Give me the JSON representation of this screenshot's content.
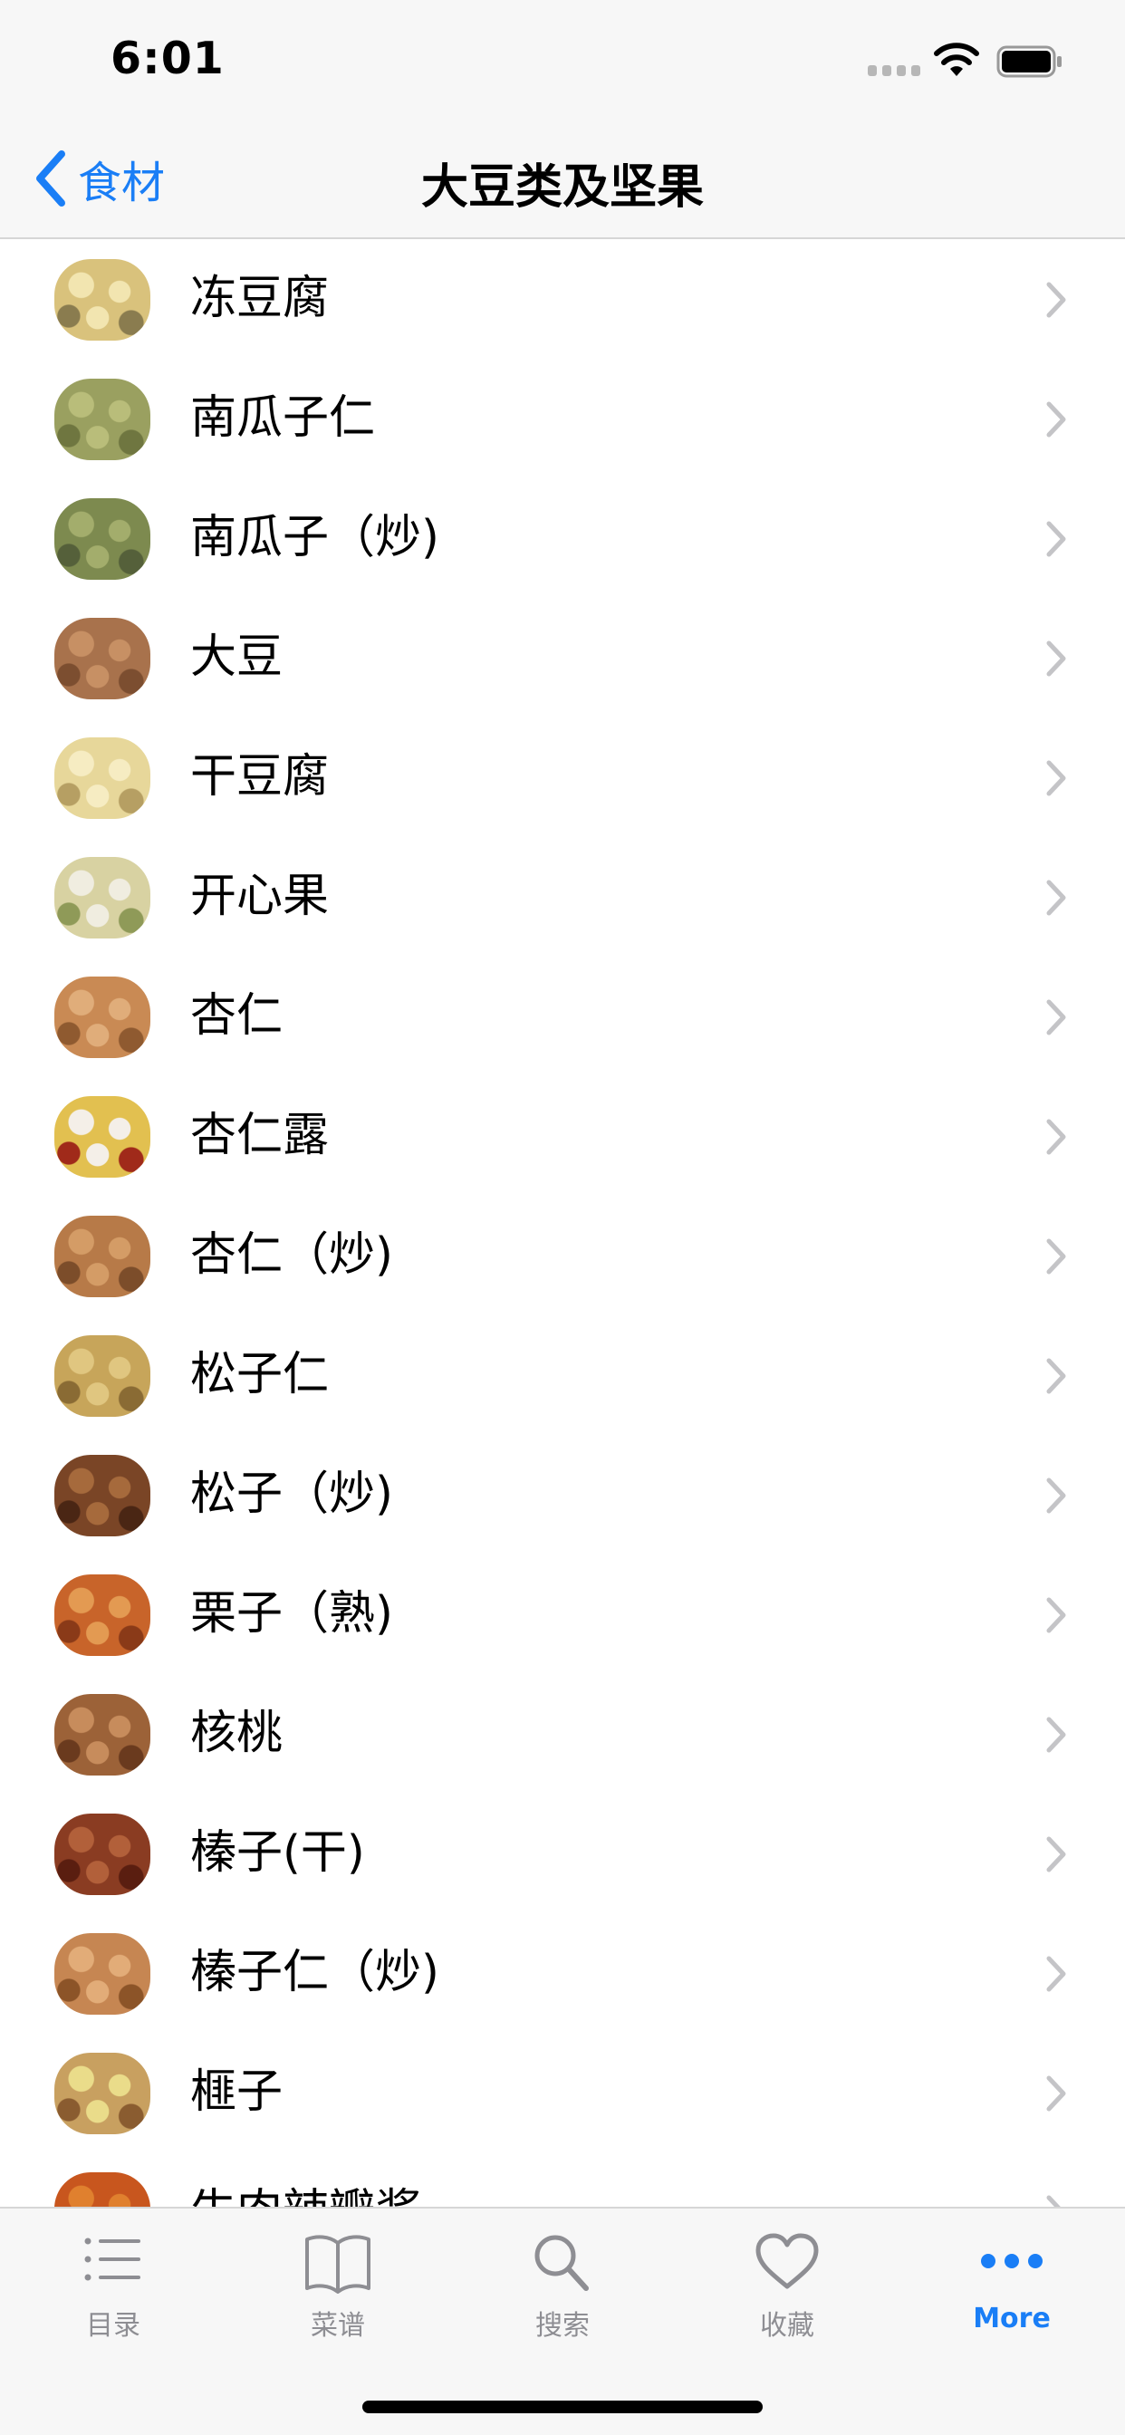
{
  "status_bar": {
    "time": "6:01"
  },
  "nav": {
    "back_label": "食材",
    "title": "大豆类及坚果"
  },
  "items": [
    {
      "label": "冻豆腐",
      "colors": [
        "#d9c27c",
        "#f2e5b0",
        "#8a7c4f"
      ]
    },
    {
      "label": "南瓜子仁",
      "colors": [
        "#9aa060",
        "#b9bd7a",
        "#6f7640"
      ]
    },
    {
      "label": "南瓜子（炒)",
      "colors": [
        "#7d8a4f",
        "#a3ad6c",
        "#55603a"
      ]
    },
    {
      "label": "大豆",
      "colors": [
        "#a8724c",
        "#c79064",
        "#7c4e30"
      ]
    },
    {
      "label": "干豆腐",
      "colors": [
        "#e7d79a",
        "#f6ecc2",
        "#b69f63"
      ]
    },
    {
      "label": "开心果",
      "colors": [
        "#d8d2a2",
        "#f0ede0",
        "#8f9a58"
      ]
    },
    {
      "label": "杏仁",
      "colors": [
        "#c98a54",
        "#e0ad7a",
        "#8f5a30"
      ]
    },
    {
      "label": "杏仁露",
      "colors": [
        "#e2c050",
        "#f4efe8",
        "#a02a1a"
      ]
    },
    {
      "label": "杏仁（炒)",
      "colors": [
        "#b77a48",
        "#d49c66",
        "#7c4d2a"
      ]
    },
    {
      "label": "松子仁",
      "colors": [
        "#c7a55a",
        "#e0c680",
        "#8a6b34"
      ]
    },
    {
      "label": "松子（炒)",
      "colors": [
        "#7a4526",
        "#a66a3c",
        "#4a2614"
      ]
    },
    {
      "label": "栗子（熟)",
      "colors": [
        "#c8642a",
        "#e39a52",
        "#8a3a18"
      ]
    },
    {
      "label": "核桃",
      "colors": [
        "#9c6238",
        "#c78c5c",
        "#6a3a1e"
      ]
    },
    {
      "label": "榛子(干)",
      "colors": [
        "#8a3c22",
        "#b2603a",
        "#5a1e10"
      ]
    },
    {
      "label": "榛子仁（炒)",
      "colors": [
        "#c68652",
        "#e2ac78",
        "#8c5428"
      ]
    },
    {
      "label": "榧子",
      "colors": [
        "#c8a060",
        "#eadc8a",
        "#8a5c30"
      ]
    },
    {
      "label": "牛肉辣瓣酱",
      "colors": [
        "#c8561e",
        "#e0802e",
        "#8c3210"
      ]
    }
  ],
  "tabs": [
    {
      "label": "目录",
      "icon": "list-icon",
      "active": false
    },
    {
      "label": "菜谱",
      "icon": "book-icon",
      "active": false
    },
    {
      "label": "搜索",
      "icon": "search-icon",
      "active": false
    },
    {
      "label": "收藏",
      "icon": "heart-icon",
      "active": false
    },
    {
      "label": "More",
      "icon": "more-icon",
      "active": true
    }
  ],
  "colors": {
    "accent": "#1a7ef6",
    "inactive": "#8e8e93",
    "bar_bg": "#f7f7f7"
  }
}
